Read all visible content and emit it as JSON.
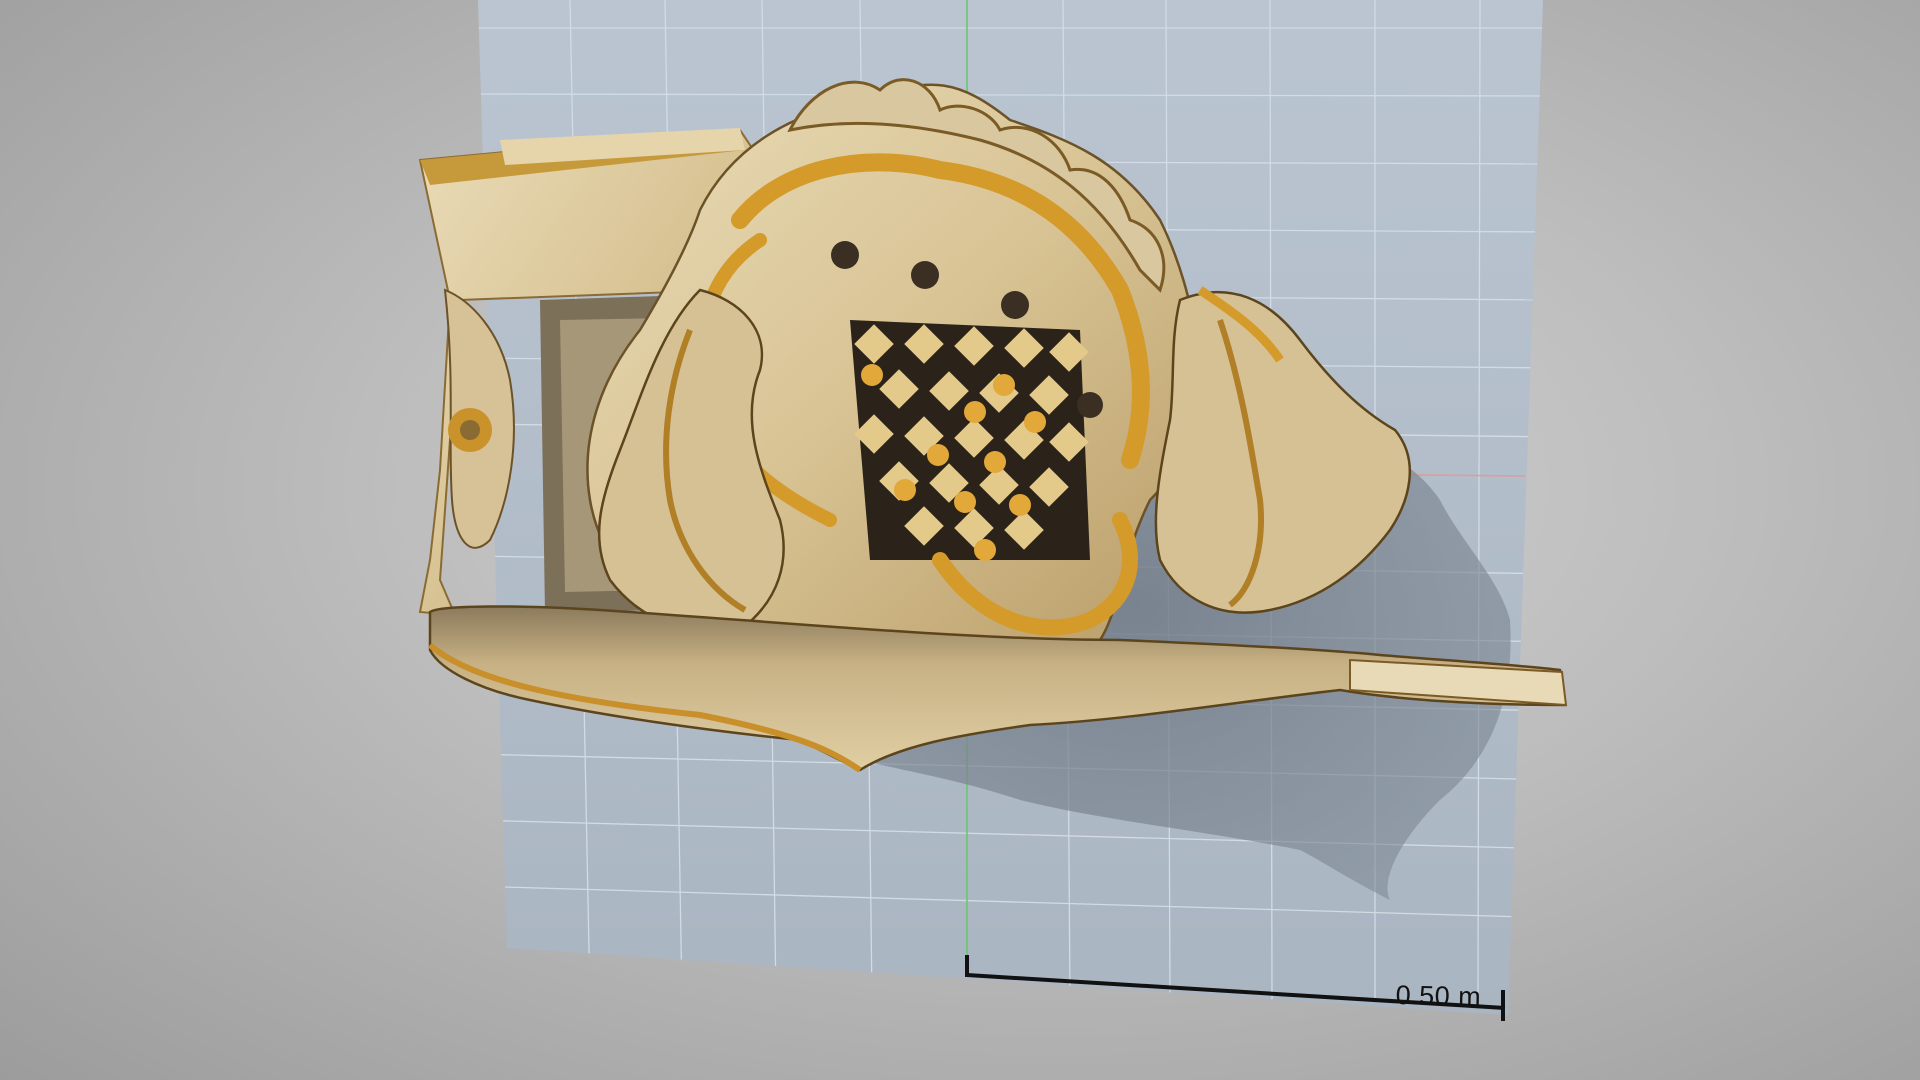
{
  "viewer": {
    "scale_bar_label": "0.50 m"
  },
  "colors": {
    "background_center": "#d2d2d2",
    "background_edge": "#9c9c9c",
    "backdrop_plane": "#b4c0cd",
    "grid_line": "#d5dde6",
    "y_axis_line": "#6cc76c",
    "x_axis_line": "#e29a9a",
    "object_cream": "#d9c7a0",
    "object_gold": "#d49a2a",
    "object_shadow": "#3a2f22",
    "scale_bar": "#111111"
  },
  "scene": {
    "object": "carved-gilded-wooden-bracket-icon",
    "grid": true,
    "axes_visible": [
      "y-axis",
      "x-axis"
    ]
  }
}
